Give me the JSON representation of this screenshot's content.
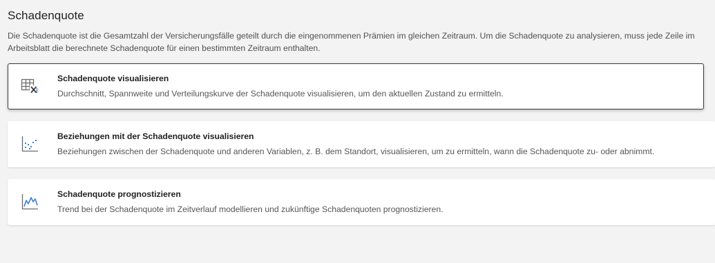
{
  "header": {
    "title": "Schadenquote",
    "description": "Die Schadenquote ist die Gesamtzahl der Versicherungsfälle geteilt durch die eingenommenen Prämien im gleichen Zeitraum. Um die Schadenquote zu analysieren, muss jede Zeile im Arbeitsblatt die berechnete Schadenquote für einen bestimmten Zeitraum enthalten."
  },
  "cards": [
    {
      "title": "Schadenquote visualisieren",
      "description": "Durchschnitt, Spannweite und Verteilungskurve der Schadenquote visualisieren, um den aktuellen Zustand zu ermitteln.",
      "icon": "table-chart-icon",
      "selected": true
    },
    {
      "title": "Beziehungen mit der Schadenquote visualisieren",
      "description": "Beziehungen zwischen der Schadenquote und anderen Variablen, z. B. dem Standort, visualisieren, um zu ermitteln, wann die Schadenquote zu- oder abnimmt.",
      "icon": "scatterplot-icon",
      "selected": false
    },
    {
      "title": "Schadenquote prognostizieren",
      "description": "Trend bei der Schadenquote im Zeitverlauf modellieren und zukünftige Schadenquoten prognostizieren.",
      "icon": "line-chart-icon",
      "selected": false
    }
  ],
  "colors": {
    "icon_blue": "#3b7dd8",
    "icon_gray": "#6b6b6b",
    "background": "#f3f3f4"
  }
}
